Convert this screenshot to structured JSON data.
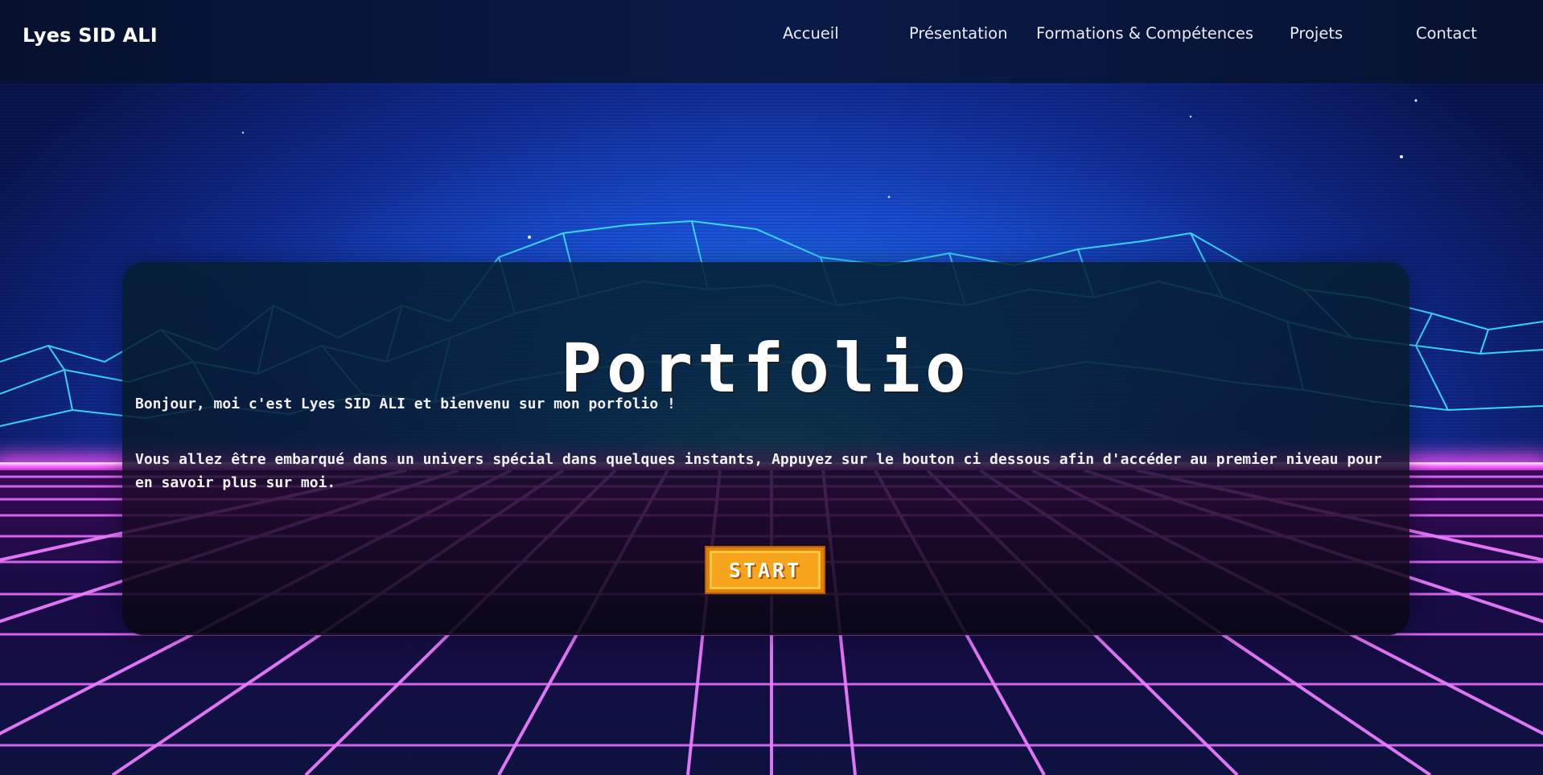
{
  "header": {
    "brand": "Lyes SID ALI",
    "nav": {
      "accueil": "Accueil",
      "presentation": "Présentation",
      "formations": "Formations & Compétences",
      "projets": "Projets",
      "contact": "Contact"
    }
  },
  "hero": {
    "title": "Portfolio",
    "intro": "Bonjour, moi c'est Lyes SID ALI et bienvenu sur mon porfolio !",
    "description": "Vous allez être embarqué dans un univers spécial dans quelques instants, Appuyez sur le bouton ci dessous afin d'accéder au premier niveau pour en savoir plus sur moi.",
    "start_label": "START"
  },
  "theme": {
    "navbar_bg": "#07122f",
    "accent_button": "#f7a51c",
    "neon_cyan": "#3fe6ff",
    "neon_pink": "#ff4ff5"
  }
}
